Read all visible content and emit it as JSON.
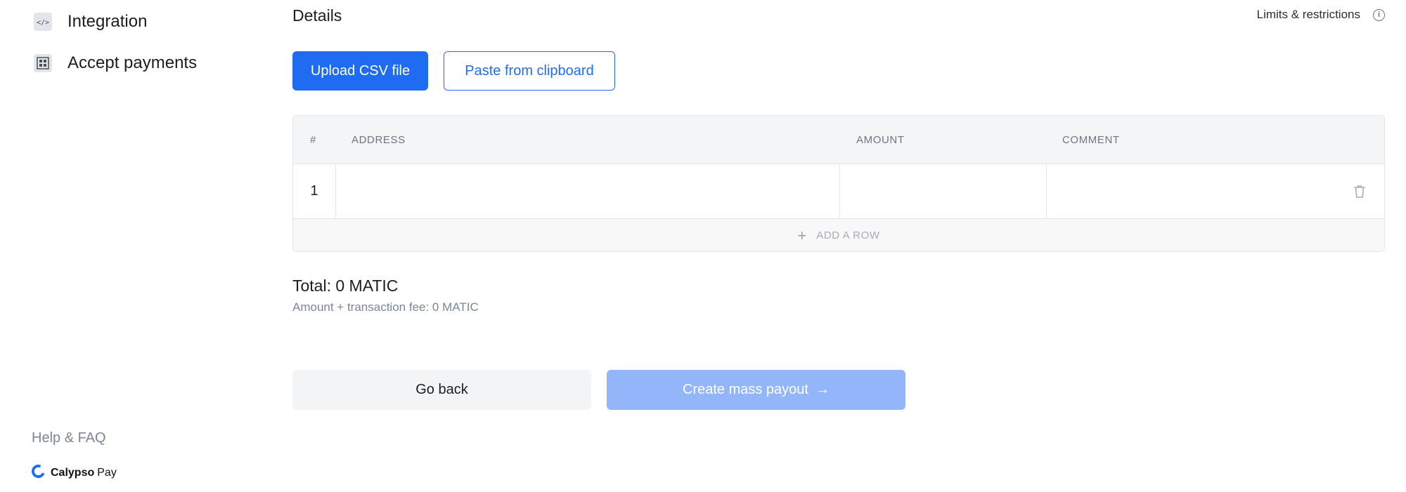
{
  "sidebar": {
    "items": [
      {
        "label": "Integration",
        "icon": "code-icon"
      },
      {
        "label": "Accept payments",
        "icon": "qr-code-icon"
      }
    ],
    "help_label": "Help & FAQ",
    "brand": {
      "name": "Calypso",
      "suffix": "Pay",
      "color": "#1f6cf2"
    }
  },
  "main": {
    "title": "Details",
    "limits_label": "Limits & restrictions",
    "upload_label": "Upload CSV file",
    "paste_label": "Paste from clipboard",
    "table": {
      "headers": [
        "#",
        "ADDRESS",
        "AMOUNT",
        "COMMENT"
      ],
      "rows": [
        {
          "index": "1",
          "address": "",
          "amount": "",
          "comment": ""
        }
      ],
      "add_row_label": "ADD A ROW"
    },
    "total_label": "Total: 0 MATIC",
    "fee_label": "Amount + transaction fee: 0 MATIC",
    "back_label": "Go back",
    "create_label": "Create mass payout",
    "create_arrow": "→"
  },
  "colors": {
    "accent": "#1f6cf2",
    "accent_disabled": "#93b6fb",
    "muted_text": "#7d8597"
  }
}
